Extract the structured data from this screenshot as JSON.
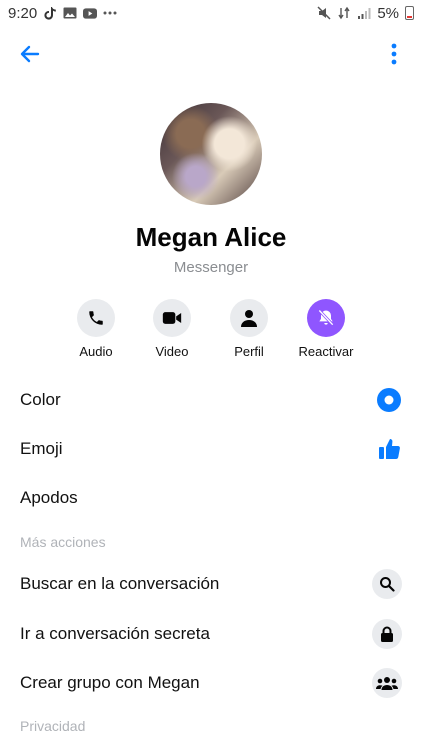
{
  "status_bar": {
    "time": "9:20",
    "battery": "5%",
    "left_icons": [
      "tiktok-icon",
      "image-icon",
      "youtube-icon",
      "more-dots-icon"
    ],
    "right_icons": [
      "mute-icon",
      "data-icon",
      "signal-icon",
      "battery-icon"
    ]
  },
  "header": {
    "back_icon": "arrow-left-icon",
    "menu_icon": "more-vertical-icon"
  },
  "profile": {
    "name": "Megan Alice",
    "subtitle": "Messenger"
  },
  "actions": [
    {
      "label": "Audio",
      "icon": "phone-icon"
    },
    {
      "label": "Video",
      "icon": "video-camera-icon"
    },
    {
      "label": "Perfil",
      "icon": "person-icon"
    },
    {
      "label": "Reactivar",
      "icon": "bell-off-icon"
    }
  ],
  "settings": [
    {
      "label": "Color",
      "icon": "color-dot-icon"
    },
    {
      "label": "Emoji",
      "icon": "thumbs-up-icon"
    },
    {
      "label": "Apodos"
    }
  ],
  "more_actions": {
    "header": "Más acciones",
    "items": [
      {
        "label": "Buscar en la conversación",
        "icon": "search-icon"
      },
      {
        "label": "Ir a conversación secreta",
        "icon": "lock-icon"
      },
      {
        "label": "Crear grupo con Megan",
        "icon": "group-icon"
      }
    ]
  },
  "privacy": {
    "header": "Privacidad"
  },
  "colors": {
    "accent_blue": "#0a7cff",
    "reactivate_purple": "#8f56ff",
    "icon_bg": "#e9ebee",
    "muted_text": "#8a8d91"
  }
}
